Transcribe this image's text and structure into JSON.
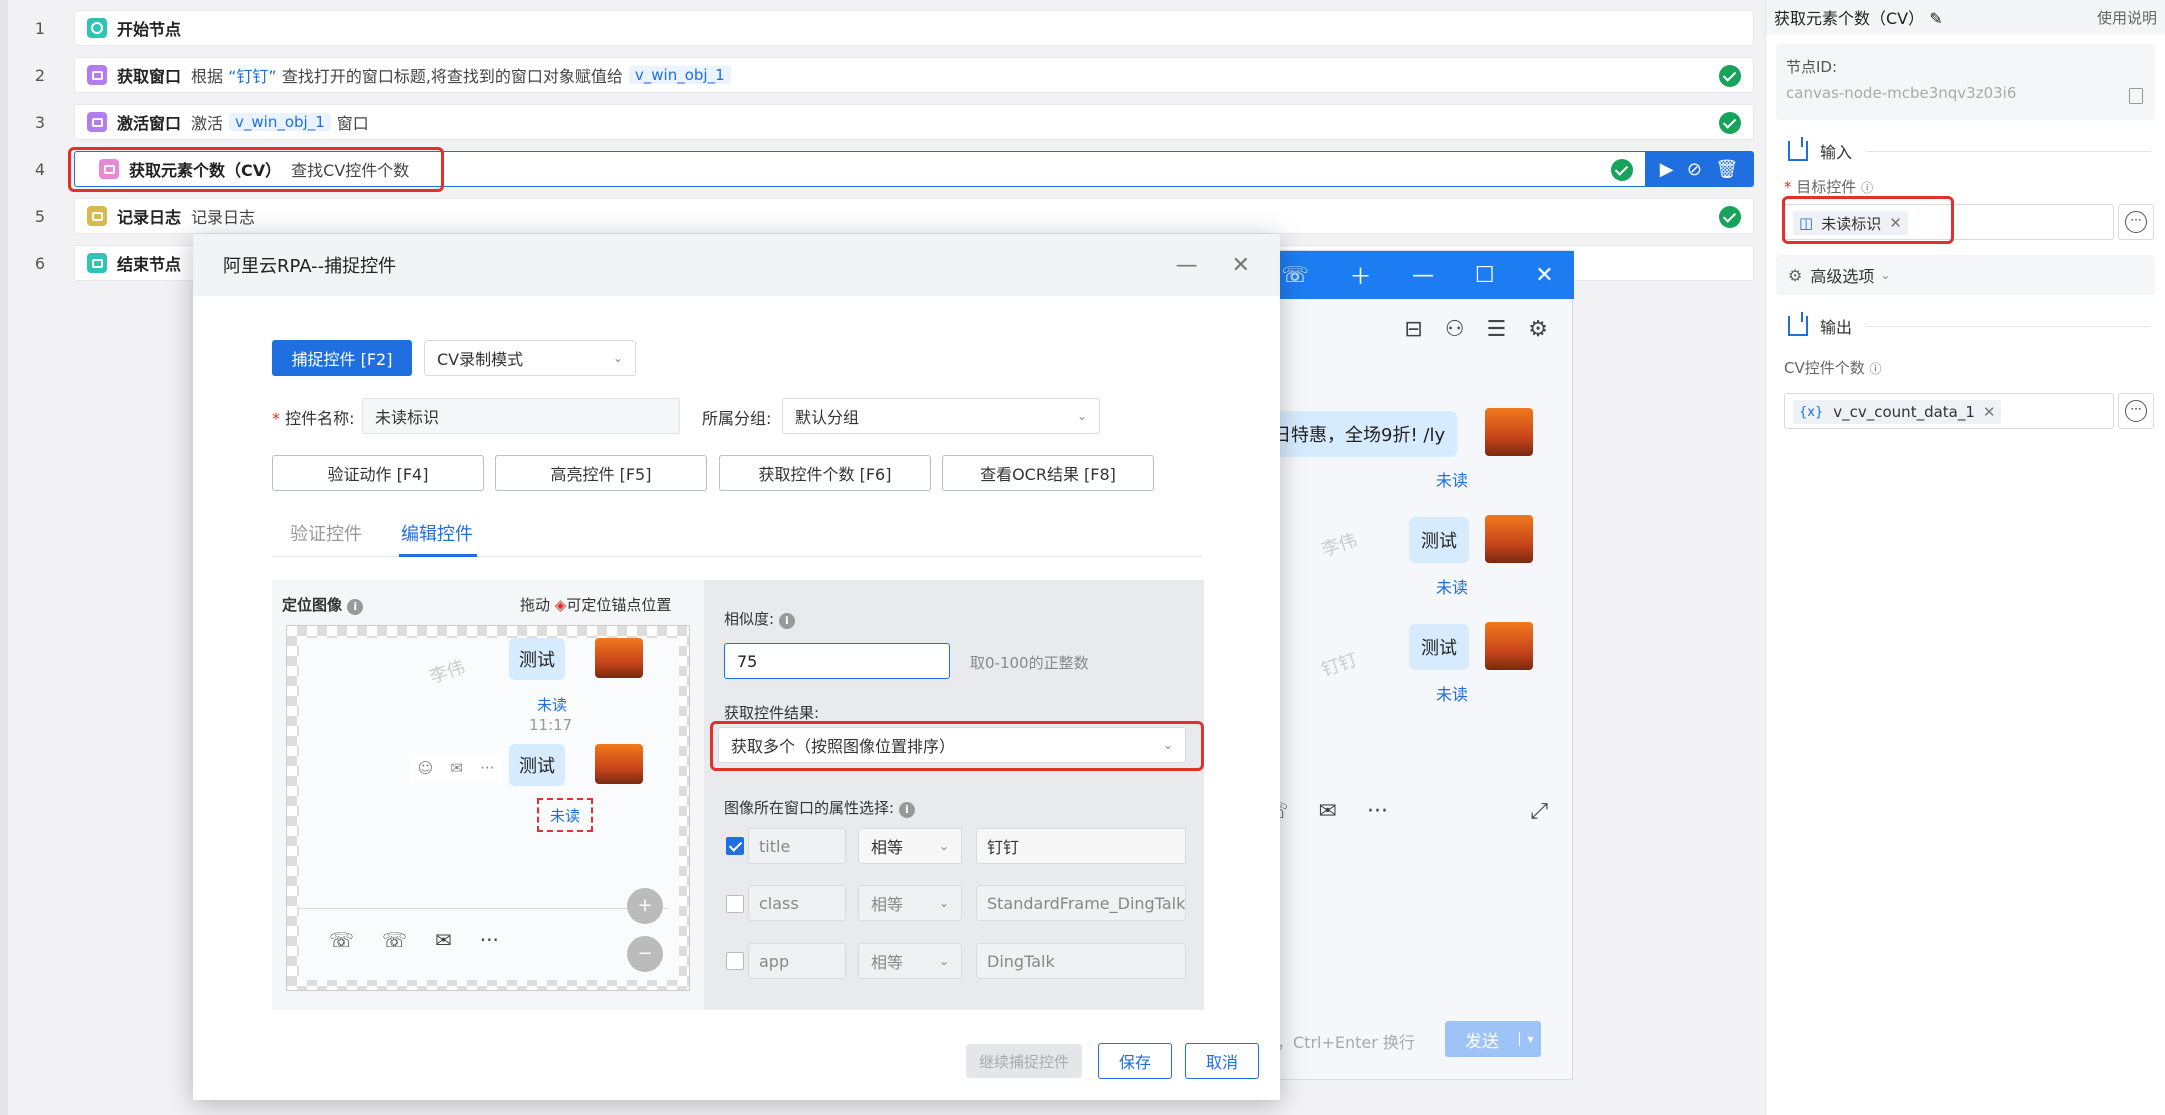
{
  "flow": {
    "rows": [
      {
        "num": "1",
        "title": "开始节点"
      },
      {
        "num": "2",
        "title": "获取窗口",
        "d1": "根据",
        "q": "“钉钉”",
        "d2": "查找打开的窗口标题,将查找到的窗口对象赋值给",
        "var": "v_win_obj_1"
      },
      {
        "num": "3",
        "title": "激活窗口",
        "d1": "激活",
        "var": "v_win_obj_1",
        "d2": "窗口"
      },
      {
        "num": "4",
        "title": "获取元素个数（CV）",
        "d1": "查找CV控件个数"
      },
      {
        "num": "5",
        "title": "记录日志",
        "d1": "记录日志"
      },
      {
        "num": "6",
        "title": "结束节点"
      }
    ],
    "colors": {
      "start": "#2ec4b6",
      "window": "#b57bf0",
      "cv": "#e889d6",
      "log": "#d7b94d",
      "end": "#2ec4b6",
      "ok": "#17a35c",
      "accent": "#1f6fe0",
      "highlight": "#e0312a"
    }
  },
  "panel": {
    "title": "获取元素个数（CV）",
    "help": "使用说明",
    "node_id_label": "节点ID:",
    "node_id": "canvas-node-mcbe3nqv3z03i6",
    "input_label": "输入",
    "target_label": "目标控件",
    "target_value": "未读标识",
    "advanced": "高级选项",
    "output_label": "输出",
    "cv_count_label": "CV控件个数",
    "cv_count_value": "v_cv_count_data_1"
  },
  "ding": {
    "msg1": "日特惠，全场9折! /ly",
    "test": "测试",
    "unread": "未读",
    "wm1": "李伟",
    "wm2": "钉钉",
    "hint": "送，Ctrl+Enter 换行",
    "send": "发送"
  },
  "dialog": {
    "title": "阿里云RPA--捕捉控件",
    "capture_btn": "捕捉控件 [F2]",
    "mode": "CV录制模式",
    "name_label": "控件名称:",
    "name_value": "未读标识",
    "group_label": "所属分组:",
    "group_value": "默认分组",
    "btn_verify": "验证动作 [F4]",
    "btn_highlight": "高亮控件 [F5]",
    "btn_count": "获取控件个数 [F6]",
    "btn_ocr": "查看OCR结果 [F8]",
    "tab_verify": "验证控件",
    "tab_edit": "编辑控件",
    "locate_label": "定位图像",
    "drag_hint_1": "拖动",
    "drag_hint_2": "可定位锚点位置",
    "preview": {
      "test": "测试",
      "unread": "未读",
      "time": "11:17",
      "mark": "未读",
      "wm": "李伟"
    },
    "similarity_label": "相似度:",
    "similarity_value": "75",
    "similarity_hint": "取0-100的正整数",
    "result_label": "获取控件结果:",
    "result_value": "获取多个（按照图像位置排序）",
    "attr_label": "图像所在窗口的属性选择:",
    "attrs": [
      {
        "key": "title",
        "op": "相等",
        "val": "钉钉",
        "checked": true
      },
      {
        "key": "class",
        "op": "相等",
        "val": "StandardFrame_DingTalk",
        "checked": false
      },
      {
        "key": "app",
        "op": "相等",
        "val": "DingTalk",
        "checked": false
      }
    ],
    "btn_continue": "继续捕捉控件",
    "btn_save": "保存",
    "btn_cancel": "取消"
  }
}
